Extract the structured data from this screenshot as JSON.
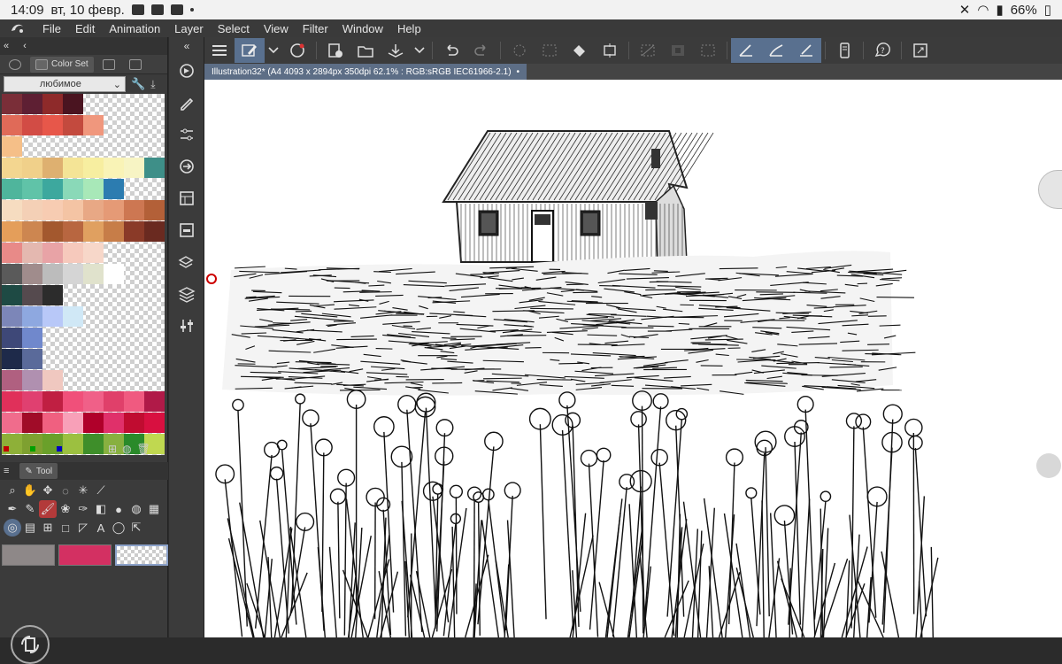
{
  "status_bar": {
    "time": "14:09",
    "date": "вт, 10 февр.",
    "battery": "66%"
  },
  "menu": [
    "File",
    "Edit",
    "Animation",
    "Layer",
    "Select",
    "View",
    "Filter",
    "Window",
    "Help"
  ],
  "color_set": {
    "tab_label": "Color Set",
    "set_name": "любимое",
    "swatch_colors": [
      [
        "#7a2e38",
        "#5e1f33",
        "#8e2a2a",
        "#4a1420"
      ],
      [
        "#e06a58",
        "#d24c45",
        "#e7574a",
        "#c34a3e",
        "#f0977d"
      ],
      [
        "#f5bf88"
      ],
      [
        "#f3d690",
        "#f0d08a",
        "#deb070",
        "#f4e496",
        "#f7eea0",
        "#f9f3b6",
        "#f7f4c4",
        "#3e8f88"
      ],
      [
        "#4fb59c",
        "#60c3a8",
        "#3da89e",
        "#8ad9b8",
        "#a8e8b8",
        "#2c7cb0"
      ],
      [
        "#f6dcc0",
        "#f4d0b6",
        "#f7ccb2",
        "#f4c4a4",
        "#e8a885",
        "#e59a76",
        "#cd7752",
        "#b36038"
      ],
      [
        "#e49e5a",
        "#cd8650",
        "#a3582e",
        "#b86640",
        "#e0a060",
        "#c77d48",
        "#8a3a28",
        "#6a2a20"
      ],
      [
        "#e88a88",
        "#e4b8b0",
        "#e8a3a6",
        "#f6c9bc",
        "#f7d7c9"
      ],
      [
        "#5a5a5a",
        "#a08c8c",
        "#bcbcbc",
        "#d5d5d5",
        "#e0e2cc",
        "#ffffff"
      ],
      [
        "#1e4a44",
        "#554a4e",
        "#2c2c2c"
      ],
      [
        "#7c86b8",
        "#8ea8e0",
        "#b8c8f8",
        "#d0e8f6"
      ],
      [
        "#3e4878",
        "#7088cc"
      ],
      [
        "#1e2a4a",
        "#5a6a9a"
      ],
      [
        "#b06080",
        "#b090b0",
        "#f0c8c0"
      ],
      [
        "#e0305a",
        "#e04070",
        "#c01f42",
        "#f0507a",
        "#f06088",
        "#e0406a",
        "#f05a80",
        "#b01a48"
      ],
      [
        "#f06c8c",
        "#a00c28",
        "#f06080",
        "#f8a0b8",
        "#b0002a",
        "#e0306a",
        "#c00c30",
        "#d81040"
      ],
      [
        "#8eb038",
        "#7ea030",
        "#6aa02a",
        "#9cc040",
        "#3e8e2a",
        "#88b040",
        "#2a8a2a",
        "#c0d850"
      ]
    ],
    "footer_chips": [
      "#c00000",
      "#00a000",
      "#0000c0"
    ]
  },
  "tool_panel": {
    "tab_label": "Tool",
    "main_color": "#8e8888",
    "sub_color": "#d33062"
  },
  "vbar_icons": [
    "navigator-icon",
    "tool-property-icon",
    "sub-tool-detail-icon",
    "auto-action-icon",
    "material-icon",
    "layer-property-icon",
    "layer-search-icon",
    "layer-icon",
    "settings-sliders-icon"
  ],
  "document": {
    "title": "Illustration32* (A4 4093 x 2894px 350dpi 62.1% : RGB:sRGB IEC61966-2.1)"
  }
}
